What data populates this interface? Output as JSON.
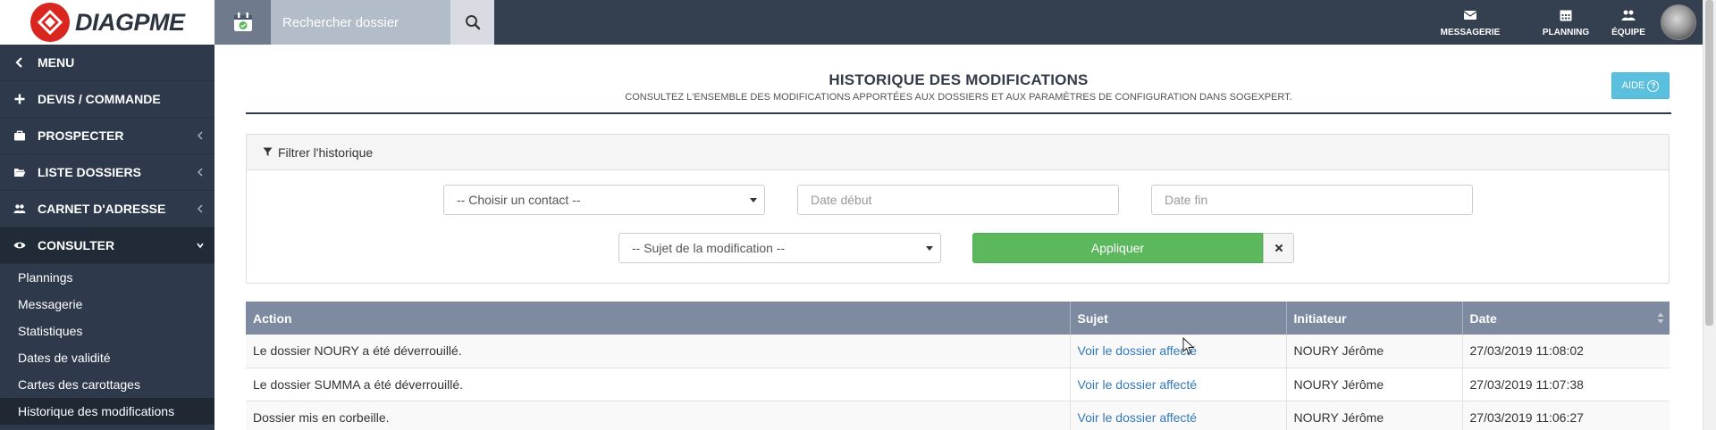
{
  "brand": {
    "name": "DIAGPME"
  },
  "search": {
    "placeholder": "Rechercher dossier"
  },
  "top_nav": [
    {
      "label": "MESSAGERIE",
      "icon": "envelope-icon"
    },
    {
      "label": "PLANNING",
      "icon": "calendar-icon"
    },
    {
      "label": "ÉQUIPE",
      "icon": "users-icon"
    }
  ],
  "sidebar": {
    "items": [
      {
        "label": "MENU",
        "icon": "chevron-left-icon"
      },
      {
        "label": "DEVIS / COMMANDE",
        "icon": "plus-icon"
      },
      {
        "label": "PROSPECTER",
        "icon": "briefcase-icon"
      },
      {
        "label": "LISTE DOSSIERS",
        "icon": "folder-open-icon"
      },
      {
        "label": "CARNET D'ADRESSE",
        "icon": "users-icon"
      },
      {
        "label": "CONSULTER",
        "icon": "eye-icon"
      }
    ],
    "sub_items": [
      "Plannings",
      "Messagerie",
      "Statistiques",
      "Dates de validité",
      "Cartes des carottages",
      "Historique des modifications"
    ]
  },
  "page": {
    "title": "HISTORIQUE DES MODIFICATIONS",
    "subtitle": "CONSULTEZ L'ENSEMBLE DES MODIFICATIONS APPORTÉES AUX DOSSIERS ET AUX PARAMÈTRES DE CONFIGURATION DANS SOGEXPERT.",
    "help_label": "AIDE",
    "help_icon": "question-circle-icon"
  },
  "filter": {
    "heading": "Filtrer l'historique",
    "contact_select": "-- Choisir un contact --",
    "date_start_placeholder": "Date début",
    "date_end_placeholder": "Date fin",
    "subject_select": "-- Sujet de la modification  --",
    "apply_label": "Appliquer"
  },
  "table": {
    "headers": [
      "Action",
      "Sujet",
      "Initiateur",
      "Date"
    ],
    "rows": [
      [
        "Le dossier NOURY a été déverrouillé.",
        "Voir le dossier affecté",
        "NOURY Jérôme",
        "27/03/2019 11:08:02"
      ],
      [
        "Le dossier SUMMA a été déverrouillé.",
        "Voir le dossier affecté",
        "NOURY Jérôme",
        "27/03/2019 11:07:38"
      ],
      [
        "Dossier mis en corbeille.",
        "Voir le dossier affecté",
        "NOURY Jérôme",
        "27/03/2019 11:06:27"
      ]
    ]
  },
  "colors": {
    "topbar": "#343f4f",
    "sidebar": "#2e3a4b",
    "table_header": "#7d8aa0",
    "apply": "#5cb85c",
    "help": "#5bc0de",
    "brand_red": "#d9271f",
    "link": "#337ab7"
  }
}
